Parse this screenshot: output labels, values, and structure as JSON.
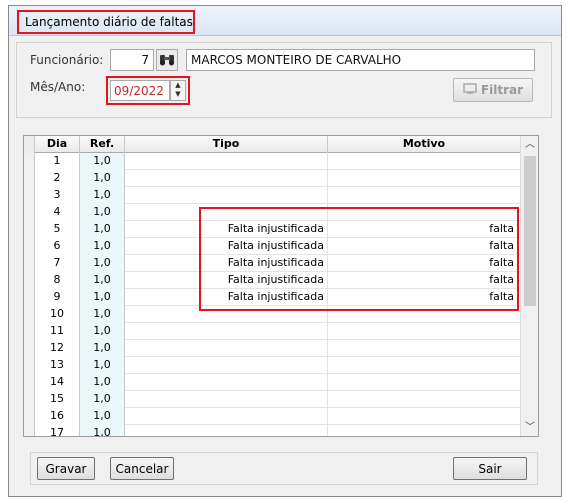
{
  "window": {
    "title": "Lançamento diário de faltas"
  },
  "form": {
    "funcionario_label": "Funcionário:",
    "funcionario_code": "7",
    "funcionario_name": "MARCOS MONTEIRO DE CARVALHO",
    "mes_ano_label": "Mês/Ano:",
    "mes_ano_value": "09/2022",
    "filtrar_label": "Filtrar"
  },
  "grid": {
    "columns": [
      "Dia",
      "Ref.",
      "Tipo",
      "Motivo"
    ],
    "rows": [
      {
        "dia": "1",
        "ref": "1,0",
        "tipo": "",
        "motivo": ""
      },
      {
        "dia": "2",
        "ref": "1,0",
        "tipo": "",
        "motivo": ""
      },
      {
        "dia": "3",
        "ref": "1,0",
        "tipo": "",
        "motivo": ""
      },
      {
        "dia": "4",
        "ref": "1,0",
        "tipo": "",
        "motivo": ""
      },
      {
        "dia": "5",
        "ref": "1,0",
        "tipo": "Falta injustificada",
        "motivo": "falta"
      },
      {
        "dia": "6",
        "ref": "1,0",
        "tipo": "Falta injustificada",
        "motivo": "falta"
      },
      {
        "dia": "7",
        "ref": "1,0",
        "tipo": "Falta injustificada",
        "motivo": "falta"
      },
      {
        "dia": "8",
        "ref": "1,0",
        "tipo": "Falta injustificada",
        "motivo": "falta"
      },
      {
        "dia": "9",
        "ref": "1,0",
        "tipo": "Falta injustificada",
        "motivo": "falta"
      },
      {
        "dia": "10",
        "ref": "1,0",
        "tipo": "",
        "motivo": ""
      },
      {
        "dia": "11",
        "ref": "1,0",
        "tipo": "",
        "motivo": ""
      },
      {
        "dia": "12",
        "ref": "1,0",
        "tipo": "",
        "motivo": ""
      },
      {
        "dia": "13",
        "ref": "1,0",
        "tipo": "",
        "motivo": ""
      },
      {
        "dia": "14",
        "ref": "1,0",
        "tipo": "",
        "motivo": ""
      },
      {
        "dia": "15",
        "ref": "1,0",
        "tipo": "",
        "motivo": ""
      },
      {
        "dia": "16",
        "ref": "1,0",
        "tipo": "",
        "motivo": ""
      },
      {
        "dia": "17",
        "ref": "1,0",
        "tipo": "",
        "motivo": ""
      }
    ]
  },
  "buttons": {
    "gravar": "Gravar",
    "cancelar": "Cancelar",
    "sair": "Sair"
  },
  "icons": {
    "finder": "binoculars-icon",
    "filter": "filter-icon"
  },
  "colors": {
    "highlight": "#e0161f",
    "ref_column": "#eaf8fb"
  }
}
